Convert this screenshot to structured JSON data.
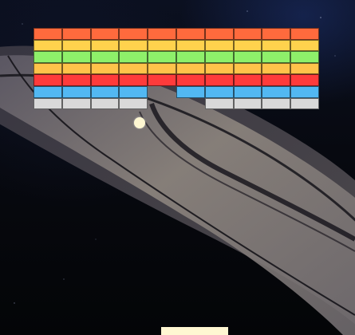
{
  "game": {
    "title": "",
    "colors": {
      "ball": "#fff7d2",
      "paddle": "#fff7d2",
      "brick_border": "#000000"
    },
    "background": "saturn-rings-space",
    "brick_grid": {
      "rows": 7,
      "cols": 10,
      "row_colors": [
        "#ff6a3d",
        "#ffd24d",
        "#8ef06a",
        "#ffc34a",
        "#ff3b3b",
        "#52b8f2",
        "#d9d9d9"
      ],
      "missing": [
        [
          5,
          4
        ],
        [
          6,
          4
        ],
        [
          6,
          5
        ]
      ]
    }
  }
}
